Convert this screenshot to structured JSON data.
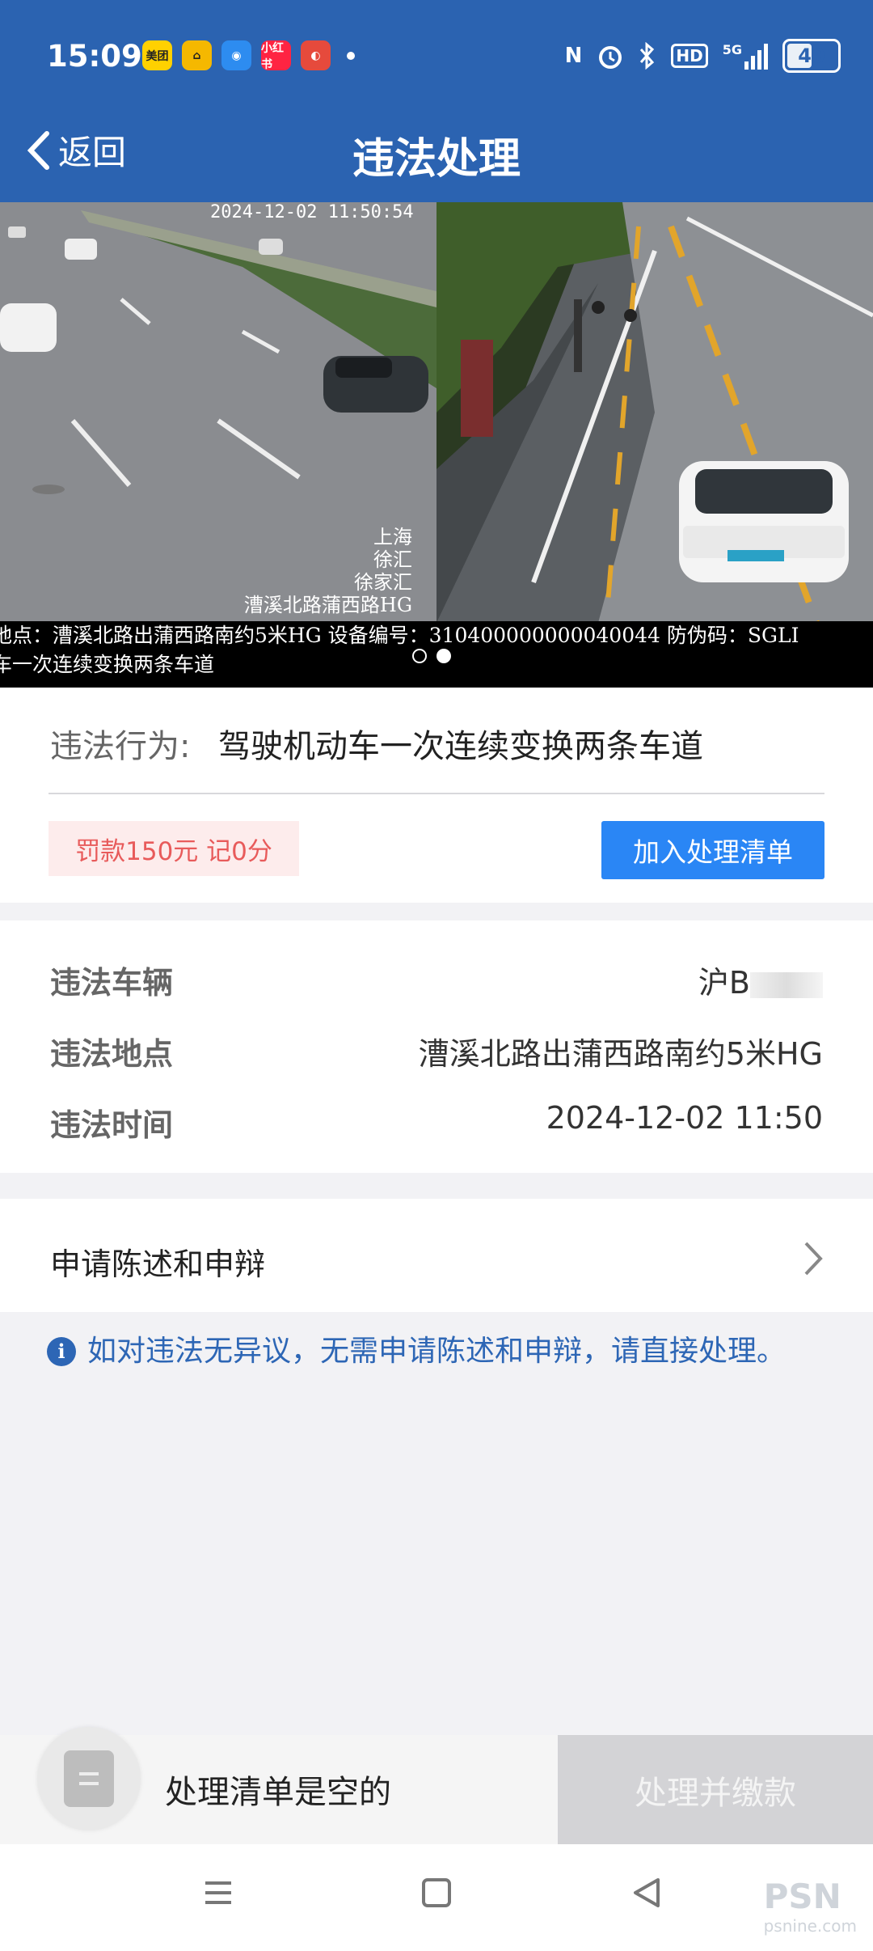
{
  "status_bar": {
    "time": "15:09",
    "app_icons": [
      {
        "name": "meituan-app-icon",
        "label": "美团",
        "color": "#ffd100",
        "text_color": "#222"
      },
      {
        "name": "didi-app-icon",
        "label": "⌂",
        "color": "#f5b800",
        "text_color": "#222"
      },
      {
        "name": "ctrip-app-icon",
        "label": "◉",
        "color": "#2d8cf0",
        "text_color": "#fff"
      },
      {
        "name": "xiaohongshu-app-icon",
        "label": "小红书",
        "color": "#ff2442",
        "text_color": "#fff"
      },
      {
        "name": "baidu-app-icon",
        "label": "◐",
        "color": "#e64a3c",
        "text_color": "#fff"
      }
    ],
    "network_label": "5G",
    "hd_label": "HD",
    "nfc_label": "N",
    "battery": "40"
  },
  "header": {
    "back_label": "返回",
    "title": "违法处理"
  },
  "photos": {
    "timestamp": "2024-12-02 11:50:54",
    "left_overlay_lines": [
      "上海",
      "徐汇",
      "徐家汇",
      "漕溪北路蒲西路HG"
    ],
    "caption_line1": "地点：漕溪北路出蒲西路南约5米HG  设备编号：310400000000040044  防伪码：SGLI",
    "caption_line2": "车一次连续变换两条车道",
    "pages": 2,
    "active_page": 2
  },
  "violation": {
    "label": "违法行为:",
    "value": "驾驶机动车一次连续变换两条车道",
    "fine_badge": "罚款150元 记0分",
    "add_button": "加入处理清单"
  },
  "details": [
    {
      "key": "违法车辆",
      "value": "沪B"
    },
    {
      "key": "违法地点",
      "value": "漕溪北路出蒲西路南约5米HG"
    },
    {
      "key": "违法时间",
      "value": "2024-12-02 11:50"
    }
  ],
  "appeal": {
    "label": "申请陈述和申辩"
  },
  "notice": {
    "text": "如对违法无异议，无需申请陈述和申辩，请直接处理。"
  },
  "bottom_bar": {
    "empty_text": "处理清单是空的",
    "pay_button": "处理并缴款"
  },
  "watermark": {
    "brand": "PSN",
    "site": "psnine.com"
  }
}
